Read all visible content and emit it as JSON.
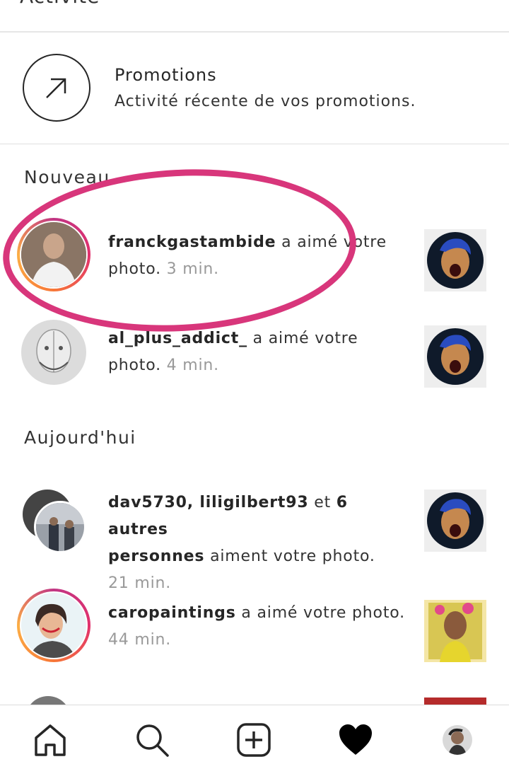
{
  "header": {
    "title": "Activité"
  },
  "promotions": {
    "title": "Promotions",
    "subtitle": "Activité récente de vos promotions.",
    "icon": "arrow-up-right-icon"
  },
  "sections": {
    "new_label": "Nouveau",
    "today_label": "Aujourd'hui"
  },
  "notifications": [
    {
      "user": "franckgastambide",
      "action": "a aimé votre",
      "line2": "photo.",
      "time": "3 min."
    },
    {
      "user": "al_plus_addict_",
      "action": "a aimé votre",
      "line2": "photo.",
      "time": "4 min."
    },
    {
      "user": "dav5730, liligilbert93",
      "connector": "et",
      "others": "6 autres",
      "others2": "personnes",
      "action": "aiment votre photo.",
      "time": "21 min."
    },
    {
      "user": "caropaintings",
      "action": "a aimé votre photo.",
      "time": "44 min."
    }
  ],
  "colors": {
    "highlight": "#d8367b",
    "story_ring": "#e1306c",
    "text": "#262626",
    "muted": "#999999"
  },
  "tabbar": {
    "items": [
      "home-icon",
      "search-icon",
      "new-post-icon",
      "activity-heart-icon",
      "profile-avatar"
    ]
  }
}
